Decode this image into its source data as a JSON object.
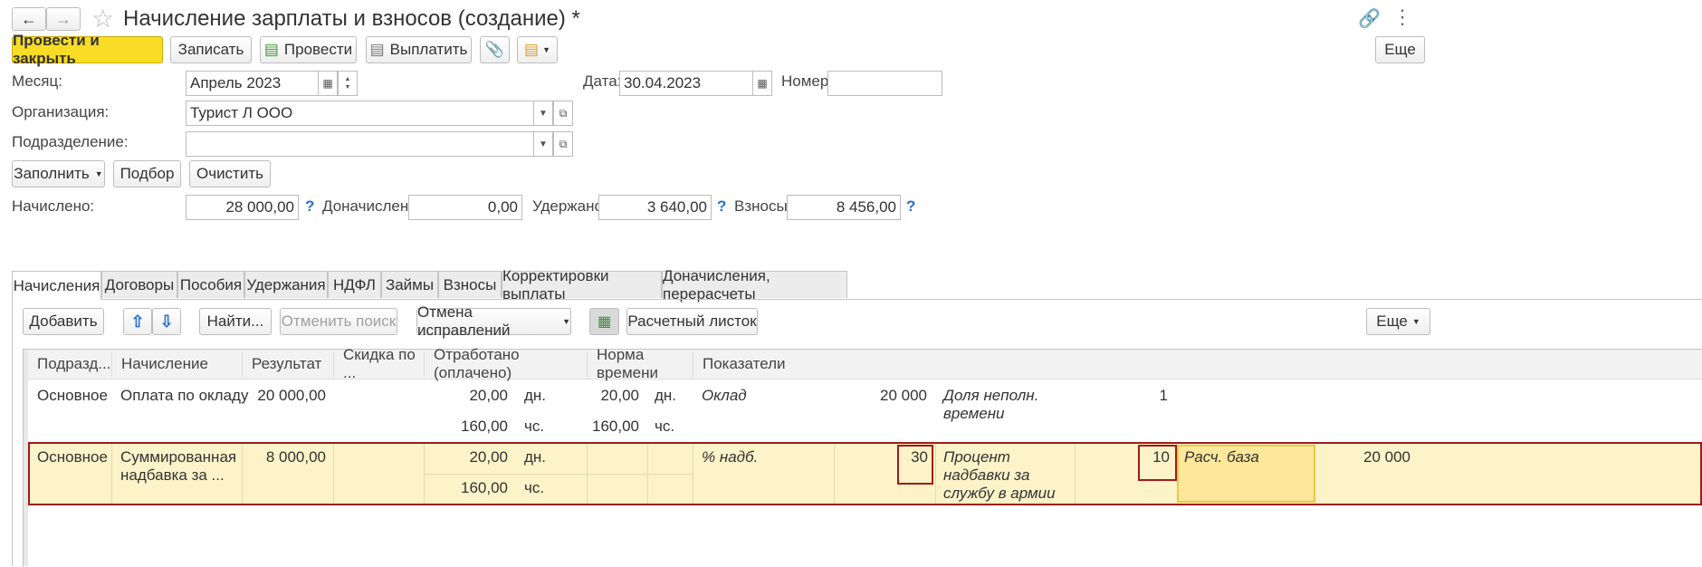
{
  "window": {
    "title": "Начисление зарплаты и взносов (создание) *"
  },
  "toolbar": {
    "post_close": "Провести и закрыть",
    "save": "Записать",
    "post": "Провести",
    "pay": "Выплатить",
    "more": "Еще"
  },
  "header": {
    "month_label": "Месяц:",
    "month_value": "Апрель 2023",
    "date_label": "Дата:",
    "date_value": "30.04.2023",
    "number_label": "Номер:",
    "number_value": "",
    "org_label": "Организация:",
    "org_value": "Турист Л ООО",
    "dept_label": "Подразделение:",
    "dept_value": ""
  },
  "actions": {
    "fill": "Заполнить",
    "select": "Подбор",
    "clear": "Очистить"
  },
  "totals": {
    "accrued_label": "Начислено:",
    "accrued_value": "28 000,00",
    "extra_label": "Доначислено:",
    "extra_value": "0,00",
    "withheld_label": "Удержано:",
    "withheld_value": "3 640,00",
    "contrib_label": "Взносы:",
    "contrib_value": "8 456,00",
    "help": "?"
  },
  "tabs": [
    "Начисления",
    "Договоры",
    "Пособия",
    "Удержания",
    "НДФЛ",
    "Займы",
    "Взносы",
    "Корректировки выплаты",
    "Доначисления, перерасчеты"
  ],
  "table_toolbar": {
    "add": "Добавить",
    "find": "Найти...",
    "cancel_search": "Отменить поиск",
    "cancel_fix": "Отмена исправлений",
    "payslip": "Расчетный листок",
    "more": "Еще"
  },
  "columns": [
    "Подразд...",
    "Начисление",
    "Результат",
    "Скидка по ...",
    "Отработано (оплачено)",
    "Норма времени",
    "Показатели"
  ],
  "rows": [
    {
      "dept": "Основное",
      "accrual": "Оплата по окладу",
      "result": "20 000,00",
      "worked_days": "20,00",
      "days_unit": "дн.",
      "worked_hours": "160,00",
      "hours_unit": "чс.",
      "norm_days": "20,00",
      "norm_days_unit": "дн.",
      "norm_hours": "160,00",
      "norm_hours_unit": "чс.",
      "ind1_name": "Оклад",
      "ind1_value": "20 000",
      "ind2_name": "Доля неполн. времени",
      "ind2_value": "1"
    },
    {
      "dept": "Основное",
      "accrual": "Суммированная надбавка за ...",
      "result": "8 000,00",
      "worked_days": "20,00",
      "days_unit": "дн.",
      "worked_hours": "160,00",
      "hours_unit": "чс.",
      "ind1_name": "% надб.",
      "ind1_value": "30",
      "ind2_name": "Процент надбавки за службу в армии",
      "ind2_value": "10",
      "ind3_name": "Расч. база",
      "ind3_value": "20 000"
    }
  ],
  "colors": {
    "accent": "#f9dc26",
    "selected_row": "#fdf3c9",
    "highlight_border": "#a01a1a",
    "base_cell": "#fde79a"
  }
}
